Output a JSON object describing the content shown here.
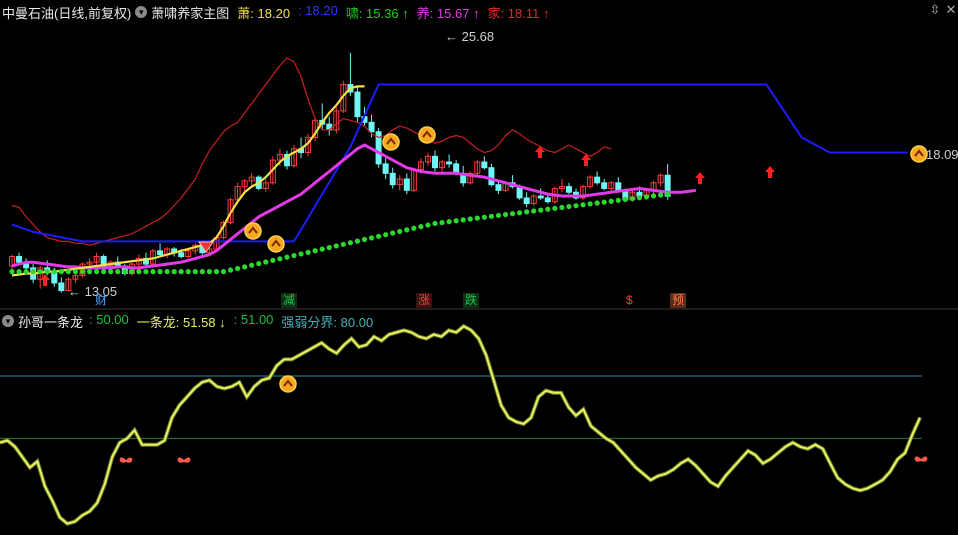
{
  "main_header": {
    "title": "中曼石油(日线,前复权)",
    "indicator_name": "萧啸养家主图",
    "items": [
      {
        "label": "萧:",
        "value": "18.20",
        "color": "#f3e14a"
      },
      {
        "label": ":",
        "value": "18.20",
        "color": "#2f37ff"
      },
      {
        "label": "啸:",
        "value": "15.36",
        "arrow": "↑",
        "color": "#19d019"
      },
      {
        "label": "养:",
        "value": "15.67",
        "arrow": "↑",
        "color": "#e23ae6"
      },
      {
        "label": "家:",
        "value": "18.11",
        "arrow": "↑",
        "color": "#e02a2a"
      }
    ]
  },
  "sub_header": {
    "indicator_name": "孙哥一条龙",
    "items": [
      {
        "label": ":",
        "value": "50.00",
        "color": "#1fbf3f"
      },
      {
        "label": "一条龙:",
        "value": "51.58",
        "arrow": "↓",
        "color": "#e9ef62"
      },
      {
        "label": ":",
        "value": "51.00",
        "color": "#1fbf3f"
      },
      {
        "label": "强弱分界:",
        "value": "80.00",
        "color": "#3fb3b8"
      }
    ]
  },
  "price_labels": {
    "high": "25.68",
    "low": "13.05",
    "last": "18.09"
  },
  "event_tags": [
    {
      "text": "财",
      "color": "#4fa3ff"
    },
    {
      "text": "减",
      "color": "#19c44a"
    },
    {
      "text": "涨",
      "color": "#ff3b3b"
    },
    {
      "text": "跌",
      "color": "#19c44a"
    },
    {
      "text": "$",
      "color": "#ff3b3b"
    },
    {
      "text": "预",
      "color": "#ff7a3b"
    }
  ],
  "window_buttons": {
    "restore": "⇳",
    "close": "✕"
  },
  "colors": {
    "up": "#ff3b3b",
    "down": "#6ff5f5",
    "xiao": "#f3e14a",
    "blue": "#1c1cff",
    "yang": "#e23ae6",
    "jia": "#c62020",
    "dots": "#29d92f",
    "osc": "#e9ef62"
  },
  "chart_data": [
    {
      "type": "candlestick",
      "title": "中曼石油(日线,前复权)",
      "ohlc": [
        [
          14.4,
          15.0,
          14.1,
          14.9
        ],
        [
          14.9,
          15.1,
          14.5,
          14.6
        ],
        [
          14.6,
          14.8,
          14.2,
          14.3
        ],
        [
          14.3,
          14.5,
          13.5,
          13.7
        ],
        [
          13.7,
          14.4,
          13.2,
          14.3
        ],
        [
          14.3,
          14.7,
          13.9,
          14.1
        ],
        [
          14.1,
          14.3,
          13.3,
          13.5
        ],
        [
          13.5,
          13.8,
          13.0,
          13.1
        ],
        [
          13.1,
          13.8,
          13.05,
          13.7
        ],
        [
          13.7,
          14.0,
          13.5,
          13.9
        ],
        [
          13.9,
          14.6,
          13.8,
          14.5
        ],
        [
          14.5,
          14.8,
          14.2,
          14.6
        ],
        [
          14.6,
          15.1,
          14.4,
          14.9
        ],
        [
          14.9,
          15.0,
          14.3,
          14.4
        ],
        [
          14.4,
          14.7,
          14.1,
          14.6
        ],
        [
          14.6,
          14.9,
          14.3,
          14.4
        ],
        [
          14.4,
          14.5,
          13.9,
          14.0
        ],
        [
          14.0,
          14.6,
          13.9,
          14.5
        ],
        [
          14.5,
          15.0,
          14.3,
          14.8
        ],
        [
          14.8,
          15.1,
          14.4,
          14.5
        ],
        [
          14.5,
          15.3,
          14.4,
          15.2
        ],
        [
          15.2,
          15.6,
          14.9,
          15.0
        ],
        [
          15.0,
          15.4,
          14.8,
          15.3
        ],
        [
          15.3,
          15.4,
          14.9,
          15.1
        ],
        [
          15.1,
          15.3,
          14.8,
          14.9
        ],
        [
          14.9,
          15.3,
          14.8,
          15.2
        ],
        [
          15.2,
          15.6,
          15.0,
          15.5
        ],
        [
          15.5,
          15.7,
          15.0,
          15.1
        ],
        [
          15.1,
          15.4,
          14.9,
          15.3
        ],
        [
          15.3,
          16.0,
          15.2,
          15.9
        ],
        [
          15.9,
          16.8,
          15.8,
          16.7
        ],
        [
          16.7,
          18.0,
          16.6,
          17.9
        ],
        [
          17.9,
          18.8,
          17.7,
          18.6
        ],
        [
          18.6,
          19.0,
          18.2,
          18.9
        ],
        [
          18.9,
          19.3,
          18.6,
          19.1
        ],
        [
          19.1,
          19.2,
          18.4,
          18.5
        ],
        [
          18.5,
          19.0,
          18.3,
          18.8
        ],
        [
          18.8,
          20.2,
          18.7,
          20.0
        ],
        [
          20.0,
          20.6,
          19.7,
          20.3
        ],
        [
          20.3,
          20.5,
          19.5,
          19.7
        ],
        [
          19.7,
          20.8,
          19.6,
          20.6
        ],
        [
          20.6,
          21.2,
          20.1,
          20.4
        ],
        [
          20.4,
          21.4,
          20.2,
          21.2
        ],
        [
          21.2,
          22.2,
          21.0,
          22.1
        ],
        [
          22.1,
          23.0,
          21.6,
          21.9
        ],
        [
          21.9,
          22.3,
          21.3,
          21.6
        ],
        [
          21.6,
          22.8,
          21.4,
          22.6
        ],
        [
          22.6,
          24.2,
          22.5,
          24.0
        ],
        [
          24.0,
          25.68,
          23.4,
          23.6
        ],
        [
          23.6,
          23.9,
          22.0,
          22.3
        ],
        [
          22.3,
          22.8,
          21.8,
          22.0
        ],
        [
          22.0,
          22.4,
          21.2,
          21.5
        ],
        [
          21.5,
          21.7,
          19.6,
          19.8
        ],
        [
          19.8,
          20.1,
          19.0,
          19.3
        ],
        [
          19.3,
          19.6,
          18.5,
          18.7
        ],
        [
          18.7,
          19.2,
          18.4,
          19.0
        ],
        [
          19.0,
          19.3,
          18.2,
          18.4
        ],
        [
          18.4,
          19.6,
          18.3,
          19.5
        ],
        [
          19.5,
          20.1,
          19.3,
          19.9
        ],
        [
          19.9,
          20.4,
          19.7,
          20.2
        ],
        [
          20.2,
          20.5,
          19.4,
          19.6
        ],
        [
          19.6,
          20.0,
          19.3,
          19.9
        ],
        [
          19.9,
          20.3,
          19.6,
          19.8
        ],
        [
          19.8,
          20.0,
          19.2,
          19.3
        ],
        [
          19.3,
          19.7,
          18.6,
          18.8
        ],
        [
          18.8,
          19.4,
          18.7,
          19.3
        ],
        [
          19.3,
          20.0,
          19.2,
          19.9
        ],
        [
          19.9,
          20.2,
          19.5,
          19.6
        ],
        [
          19.6,
          19.8,
          18.6,
          18.7
        ],
        [
          18.7,
          18.9,
          18.2,
          18.4
        ],
        [
          18.4,
          18.9,
          18.3,
          18.8
        ],
        [
          18.8,
          19.2,
          18.5,
          18.6
        ],
        [
          18.6,
          18.7,
          17.9,
          18.0
        ],
        [
          18.0,
          18.3,
          17.5,
          17.7
        ],
        [
          17.7,
          18.2,
          17.6,
          18.1
        ],
        [
          18.1,
          18.5,
          17.9,
          18.0
        ],
        [
          18.0,
          18.2,
          17.7,
          17.8
        ],
        [
          17.8,
          18.6,
          17.7,
          18.5
        ],
        [
          18.5,
          19.0,
          18.3,
          18.6
        ],
        [
          18.6,
          18.8,
          18.2,
          18.3
        ],
        [
          18.3,
          18.5,
          17.9,
          18.0
        ],
        [
          18.0,
          18.7,
          17.9,
          18.6
        ],
        [
          18.6,
          19.2,
          18.5,
          19.1
        ],
        [
          19.1,
          19.4,
          18.7,
          18.8
        ],
        [
          18.8,
          19.0,
          18.4,
          18.5
        ],
        [
          18.5,
          18.9,
          18.3,
          18.8
        ],
        [
          18.8,
          19.1,
          18.3,
          18.4
        ],
        [
          18.4,
          18.5,
          17.8,
          17.9
        ],
        [
          17.9,
          18.4,
          17.8,
          18.3
        ],
        [
          18.3,
          18.6,
          18.0,
          18.1
        ],
        [
          18.1,
          18.5,
          17.9,
          18.4
        ],
        [
          18.4,
          18.9,
          18.2,
          18.8
        ],
        [
          18.8,
          19.3,
          18.6,
          19.2
        ],
        [
          19.2,
          19.8,
          17.9,
          18.09
        ]
      ],
      "lines": {
        "xiao": [
          13.9,
          13.95,
          14.0,
          14.0,
          14.05,
          14.1,
          14.1,
          14.15,
          14.2,
          14.25,
          14.3,
          14.35,
          14.4,
          14.45,
          14.5,
          14.55,
          14.6,
          14.65,
          14.7,
          14.75,
          14.8,
          14.9,
          15.0,
          15.1,
          15.2,
          15.3,
          15.4,
          15.5,
          15.6,
          15.9,
          16.5,
          17.2,
          17.8,
          18.3,
          18.6,
          18.8,
          19.1,
          19.5,
          19.9,
          20.2,
          20.4,
          20.6,
          20.9,
          21.4,
          22.0,
          22.5,
          22.9,
          23.4,
          23.8,
          23.9,
          23.9
        ],
        "blue_steps": [
          [
            0,
            16.6
          ],
          [
            3,
            16.2
          ],
          [
            10,
            15.7
          ],
          [
            35,
            15.7
          ],
          [
            40,
            15.7
          ],
          [
            48,
            20.7
          ],
          [
            52,
            24.0
          ],
          [
            107,
            24.0
          ],
          [
            112,
            21.2
          ],
          [
            116,
            20.4
          ],
          [
            127,
            20.4
          ]
        ],
        "yang": [
          14.4,
          14.5,
          14.6,
          14.6,
          14.55,
          14.5,
          14.45,
          14.4,
          14.35,
          14.35,
          14.3,
          14.3,
          14.3,
          14.3,
          14.3,
          14.35,
          14.35,
          14.3,
          14.3,
          14.35,
          14.4,
          14.45,
          14.5,
          14.55,
          14.6,
          14.7,
          14.8,
          14.9,
          15.0,
          15.2,
          15.5,
          15.8,
          16.1,
          16.4,
          16.7,
          17.0,
          17.2,
          17.4,
          17.6,
          17.8,
          18.0,
          18.2,
          18.5,
          18.8,
          19.1,
          19.4,
          19.7,
          20.0,
          20.3,
          20.6,
          20.8,
          20.6,
          20.4,
          20.2,
          20.0,
          19.8,
          19.6,
          19.5,
          19.4,
          19.35,
          19.3,
          19.3,
          19.3,
          19.3,
          19.25,
          19.2,
          19.15,
          19.1,
          19.0,
          18.9,
          18.8,
          18.7,
          18.6,
          18.5,
          18.4,
          18.3,
          18.2,
          18.15,
          18.1,
          18.1,
          18.1,
          18.1,
          18.15,
          18.2,
          18.25,
          18.3,
          18.35,
          18.4,
          18.45,
          18.5,
          18.45,
          18.4,
          18.35,
          18.3,
          18.3,
          18.3,
          18.35,
          18.4
        ],
        "jia": [
          17.6,
          17.5,
          17.0,
          16.6,
          16.2,
          15.9,
          15.8,
          15.7,
          15.7,
          15.6,
          15.6,
          15.5,
          15.6,
          15.7,
          15.8,
          15.9,
          16.0,
          16.1,
          16.3,
          16.5,
          16.7,
          16.9,
          17.2,
          17.6,
          18.0,
          18.5,
          19.0,
          19.8,
          20.5,
          21.0,
          21.5,
          21.8,
          22.0,
          22.5,
          23.0,
          23.5,
          24.0,
          24.5,
          25.0,
          25.4,
          25.2,
          24.4,
          23.2,
          22.2,
          21.6,
          21.6,
          21.9,
          22.2,
          22.1,
          22.0,
          21.8,
          21.4,
          21.2,
          21.3,
          21.6,
          21.8,
          21.7,
          21.5,
          21.3,
          21.1,
          20.9,
          21.0,
          21.2,
          21.3,
          21.2,
          20.9,
          20.6,
          20.4,
          20.5,
          20.8,
          21.3,
          21.6,
          21.4,
          21.1,
          20.9,
          20.7,
          20.5,
          20.4,
          20.6,
          20.8,
          20.6,
          20.4,
          20.2,
          20.4,
          20.7,
          20.6
        ]
      },
      "ylim": [
        12.6,
        27.2
      ]
    },
    {
      "type": "line",
      "title": "孙哥一条龙",
      "values": [
        48,
        49,
        46,
        41,
        36,
        39,
        27,
        20,
        12,
        9,
        10,
        13,
        15,
        19,
        28,
        41,
        48,
        50,
        54,
        47,
        47,
        47,
        49,
        60,
        66,
        70,
        74,
        77,
        78,
        75,
        74,
        75,
        77,
        70,
        75,
        78,
        79,
        85,
        88,
        88,
        90,
        92,
        94,
        96,
        93,
        91,
        95,
        98,
        94,
        95,
        99,
        97,
        100,
        101,
        102,
        101,
        99,
        98,
        100,
        99,
        102,
        101,
        104,
        102,
        98,
        90,
        78,
        66,
        60,
        58,
        57,
        60,
        70,
        73,
        72,
        72,
        65,
        61,
        64,
        56,
        53,
        50,
        48,
        44,
        40,
        36,
        33,
        30,
        32,
        33,
        35,
        38,
        40,
        37,
        33,
        29,
        27,
        32,
        36,
        40,
        44,
        42,
        38,
        40,
        43,
        46,
        48,
        46,
        45,
        47,
        45,
        38,
        31,
        28,
        26,
        25,
        26,
        28,
        30,
        34,
        40,
        43,
        52,
        60
      ],
      "levels": {
        "zero_line": 50.0,
        "boundary": 80.0
      },
      "ylim": [
        5,
        106
      ]
    }
  ]
}
